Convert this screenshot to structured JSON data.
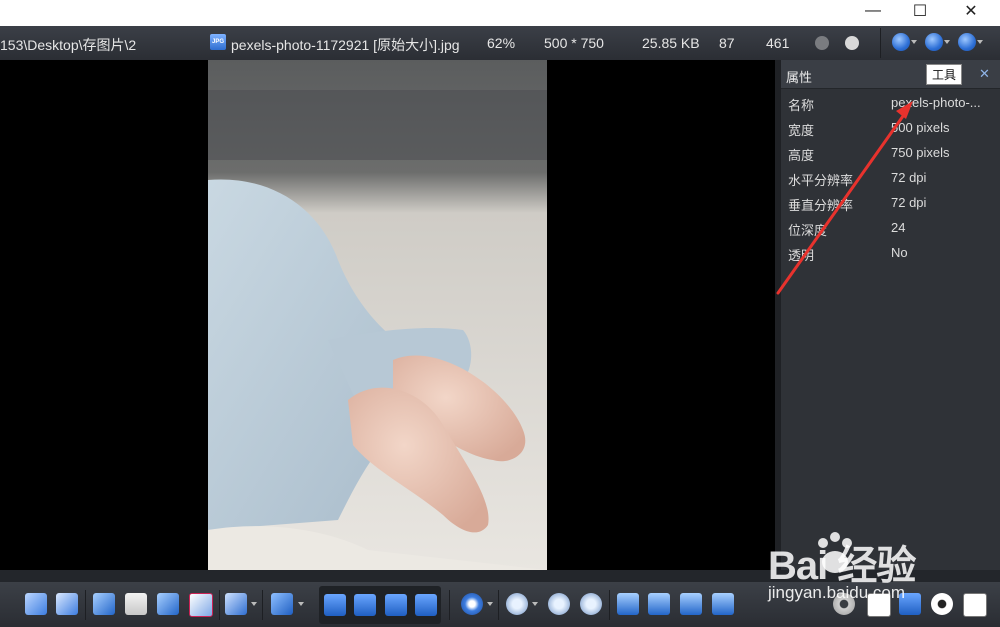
{
  "window": {
    "minimize_glyph": "—",
    "maximize_glyph": "☐",
    "close_glyph": "✕"
  },
  "infobar": {
    "path": "153\\Desktop\\存图片\\2",
    "file_icon": "JPG",
    "filename": "pexels-photo-1172921 [原始大小].jpg",
    "zoom": "62%",
    "dimensions": "500 * 750",
    "filesize": "25.85 KB",
    "index_a": "87",
    "index_b": "461"
  },
  "panel": {
    "title": "属性",
    "tooltip": "工具",
    "close_glyph": "✕",
    "rows": [
      {
        "key": "名称",
        "value": "pexels-photo-..."
      },
      {
        "key": "宽度",
        "value": "500 pixels"
      },
      {
        "key": "高度",
        "value": "750 pixels"
      },
      {
        "key": "水平分辨率",
        "value": "72 dpi"
      },
      {
        "key": "垂直分辨率",
        "value": "72 dpi"
      },
      {
        "key": "位深度",
        "value": "24"
      },
      {
        "key": "透明",
        "value": "No"
      }
    ]
  },
  "watermark": {
    "brand": "Bai  经验",
    "url": "jingyan.baidu.com"
  },
  "colors": {
    "bar_dark": "#2b2e34",
    "panel_bg": "#2f3237",
    "accent_blue": "#2d6fd6",
    "annotation_red": "#e8322d"
  }
}
